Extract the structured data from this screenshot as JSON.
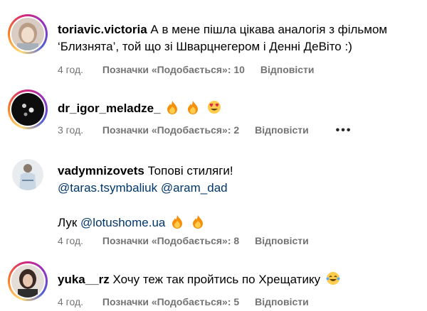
{
  "comments": [
    {
      "username": "toriavic.victoria",
      "text": "А в мене пішла цікава аналогія з фільмом ‘Близнята’, той що зі Шварцнегером і Денні ДеВіто :)",
      "time": "4 год.",
      "likes": "Позначки «Подобається»: 10",
      "reply": "Відповісти"
    },
    {
      "username": "dr_igor_meladze_",
      "text": "",
      "emojis": [
        "fire-emoji",
        "fire-emoji",
        "heart-eyes-emoji"
      ],
      "time": "3 год.",
      "likes": "Позначки «Подобається»: 2",
      "reply": "Відповісти",
      "more": "•••"
    },
    {
      "username": "vadymnizovets",
      "text": "Топові стиляги!",
      "mentions": [
        "@taras.tsymbaliuk",
        "@aram_dad"
      ],
      "line3_prefix": "Лук",
      "line3_mention": "@lotushome.ua",
      "line3_emojis": [
        "fire-emoji",
        "fire-emoji"
      ],
      "time": "4 год.",
      "likes": "Позначки «Подобається»: 8",
      "reply": "Відповісти"
    },
    {
      "username": "yuka__rz",
      "text": "Хочу теж так пройтись по Хрещатику",
      "emojis": [
        "laughing-tears-emoji"
      ],
      "time": "4 год.",
      "likes": "Позначки «Подобається»: 5",
      "reply": "Відповісти"
    }
  ],
  "colors": {
    "mention": "#00376b",
    "meta": "#737373"
  }
}
